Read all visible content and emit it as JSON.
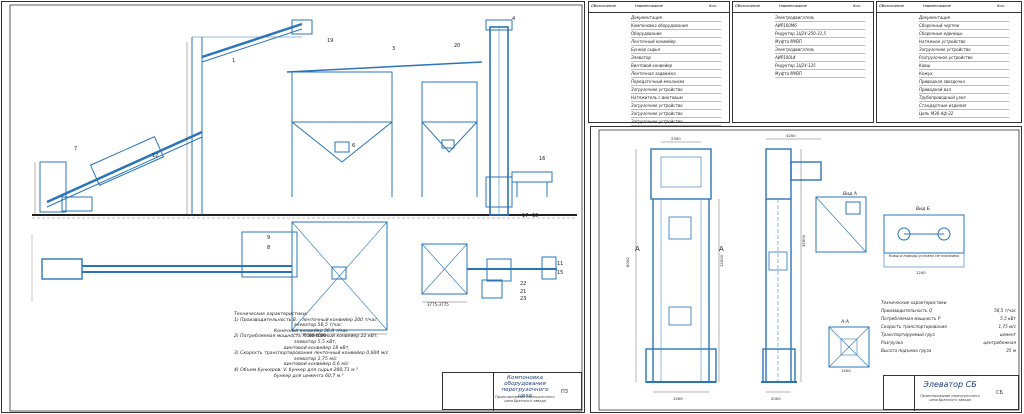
{
  "sheet_left": {
    "title_block": {
      "title": "Компоновка оборудования перегрузочного цеха",
      "subtitle": "Проектирование перегрузочного цеха Братского завода",
      "sheet": "Лист",
      "sheets": "Листов",
      "code": "ПЗ"
    },
    "tech_notes": {
      "heading": "Технические характеристики:",
      "lines": [
        "1) Производительность В. - ленточный конвейер 200 т/час",
        "элеватор 56,5 т/час",
        "Конечный конвейер 36,0 т/час",
        "2) Потребляемая мощность Р: ленточный конвейер 22 кВт,",
        "элеватор 5,5 кВт,",
        "винтовой конвейер 18 кВт,",
        "3) Скорость транспортирования ленточный конвейер 0,604 м/с",
        "элеватор 1,75 м/с",
        "винтовой конвейер 0,6 м/с",
        "4) Объем бункеров: V. бункер для сырья 280,71 м.³",
        "бункер для цемента 60,7 м.³"
      ]
    },
    "callouts": [
      "1",
      "2",
      "3",
      "4",
      "5",
      "6",
      "7",
      "8",
      "9",
      "10",
      "11",
      "12",
      "13",
      "14",
      "15",
      "16",
      "17",
      "18",
      "19",
      "20",
      "21",
      "22",
      "23"
    ]
  },
  "spec_tables": [
    {
      "headers": [
        "Обозначение",
        "Наименование",
        "Кол.",
        "Примеч."
      ],
      "rows": [
        "Документация",
        "Компоновка оборудования",
        "Оборудование",
        "Ленточный конвейер",
        "Бункер сырья",
        "Элеватор",
        "Винтовой конвейер",
        "Ленточная задвижка",
        "Передаточный механизм",
        "Загрузочное устройство",
        "Натяжитель с винтовым",
        "Загрузочное устройство",
        "Загрузочное устройство",
        "Загрузочное устройство"
      ]
    },
    {
      "headers": [
        "Обозначение",
        "Наименование",
        "Кол.",
        "Примеч."
      ],
      "rows": [
        "Электродвигатель",
        "АИР160М6",
        "Редуктор 1Ц2У-250-31,5",
        "Муфта МУВП",
        "Электродвигатель",
        "АИР100L4",
        "Редуктор 1Ц2У-125",
        "Муфта МУВП"
      ]
    },
    {
      "headers": [
        "Обозначение",
        "Наименование",
        "Кол.",
        "Примеч."
      ],
      "rows": [
        "Документация",
        "Сборочный чертеж",
        "Сборочные единицы",
        "Натяжное устройство",
        "Загрузочное устройство",
        "Разгрузочное устройство",
        "Ковш",
        "Кожух",
        "Приводная звездочка",
        "Приводной вал",
        "Трубопроводный узел",
        "Стандартные изделия",
        "Цепь М30-4ф-22"
      ]
    }
  ],
  "sheet_right": {
    "title_block": {
      "title": "Элеватор СБ",
      "subtitle": "Проектирование перегрузочного цеха Братского завода",
      "code": "СБ"
    },
    "section_labels": [
      "А",
      "А",
      "Вид А",
      "А-А",
      "Вид Б"
    ],
    "note_box": "Ковш и поводы условно не показаны",
    "tech_heading": "Технические характеристики",
    "tech_lines": [
      {
        "label": "Производительность Q",
        "value": "56,5 т/час"
      },
      {
        "label": "Потребляемая мощность Р",
        "value": "5,5 кВт"
      },
      {
        "label": "Скорость транспортирования",
        "value": "1,75 м/с"
      },
      {
        "label": "Транспортируемый груз",
        "value": "цемент"
      },
      {
        "label": "Разгрузка",
        "value": "центробежная"
      },
      {
        "label": "Высота подъема груза",
        "value": "35 м"
      }
    ],
    "dimensions": [
      "2300",
      "6000",
      "4200",
      "1500",
      "12000",
      "35500",
      "2000",
      "1500",
      "1200"
    ]
  }
}
